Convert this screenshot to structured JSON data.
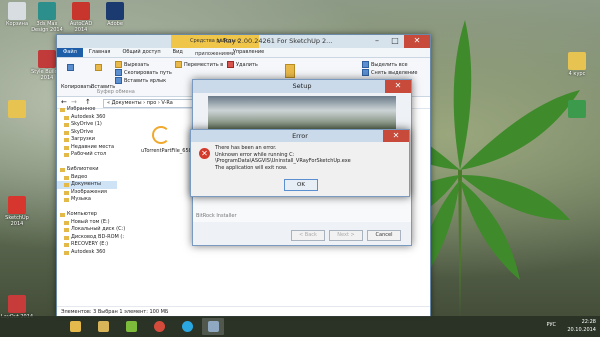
{
  "desktop": {
    "icons": [
      {
        "label": "Корзина",
        "color": "#d8dde2"
      },
      {
        "label": "3ds Max Design 2014",
        "color": "#2d8f8b"
      },
      {
        "label": "AutoCAD 2014",
        "color": "#c8352d"
      },
      {
        "label": "Adobe",
        "color": "#1b3a6f"
      },
      {
        "label": "Style Builder 2014",
        "color": "#c23b3b"
      },
      {
        "label": "SketchUp 2014",
        "color": "#d7362e"
      },
      {
        "label": "",
        "color": "#e7c352"
      },
      {
        "label": "4 курс",
        "color": "#e7c352"
      },
      {
        "label": "",
        "color": "#3c9a4d"
      },
      {
        "label": "LayOut 2014",
        "color": "#c83b3b"
      }
    ]
  },
  "explorer": {
    "context_tab": "Средства работы с приложениями",
    "title": "V-Ray 2.00.24261 For SketchUp 2...",
    "ribbon_tabs": [
      "Файл",
      "Главная",
      "Общий доступ",
      "Вид",
      "Управление"
    ],
    "ribbon": {
      "copy": "Копировать",
      "paste": "Вставить",
      "cut": "Вырезать",
      "copy_path": "Скопировать путь",
      "paste_shortcut": "Вставить ярлык",
      "clipboard_group": "Буфер обмена",
      "move_to": "Переместить в",
      "delete": "Удалить",
      "select_all": "Выделить все",
      "deselect": "Снять выделение"
    },
    "address": "« Документы › про › V-Ra",
    "nav": [
      {
        "label": "Избранное",
        "head": true
      },
      {
        "label": "Autodesk 360"
      },
      {
        "label": "SkyDrive (1)"
      },
      {
        "label": "SkyDrive"
      },
      {
        "label": "Загрузки"
      },
      {
        "label": "Недавние места"
      },
      {
        "label": "Рабочий стол"
      },
      {
        "label": "",
        "spacer": true
      },
      {
        "label": "Библиотеки",
        "head": true
      },
      {
        "label": "Видео"
      },
      {
        "label": "Документы",
        "selected": true
      },
      {
        "label": "Изображения"
      },
      {
        "label": "Музыка"
      },
      {
        "label": "",
        "spacer": true
      },
      {
        "label": "Компьютер",
        "head": true
      },
      {
        "label": "Новый том (E:)"
      },
      {
        "label": "Локальный диск (C:)"
      },
      {
        "label": "Дисковод BD-ROM (:"
      },
      {
        "label": "RECOVERY (E:)"
      },
      {
        "label": "Autodesk 360"
      }
    ],
    "file": {
      "name": "uTorrentPartFile_65847D"
    },
    "status": "Элементов: 3     Выбран 1 элемент: 100 МБ"
  },
  "setup": {
    "title": "Setup",
    "installer_label": "BitRock Installer",
    "back": "< Back",
    "next": "Next >",
    "cancel": "Cancel"
  },
  "error": {
    "title": "Error",
    "lines": [
      "There has been an error.",
      "Unknown error while running C:",
      "\\ProgramData\\ASGVIS\\Uninstall_VRayForSketchUp.exe",
      "The application will exit now."
    ],
    "ok": "OK"
  },
  "taskbar": {
    "apps": [
      {
        "name": "file-explorer-icon",
        "color": "#e5b94c"
      },
      {
        "name": "windows-explorer-icon",
        "color": "#d9b55a"
      },
      {
        "name": "green-app-icon",
        "color": "#7dbb3a"
      },
      {
        "name": "chrome-icon",
        "color": "#d44b3b"
      },
      {
        "name": "skype-icon",
        "color": "#2aa6e0"
      },
      {
        "name": "photoshop-icon",
        "color": "#2a5aa8"
      },
      {
        "name": "setup-app-icon",
        "color": "#8fa9c3"
      }
    ],
    "lang": "РУС",
    "time": "22:28",
    "date": "20.10.2014"
  }
}
